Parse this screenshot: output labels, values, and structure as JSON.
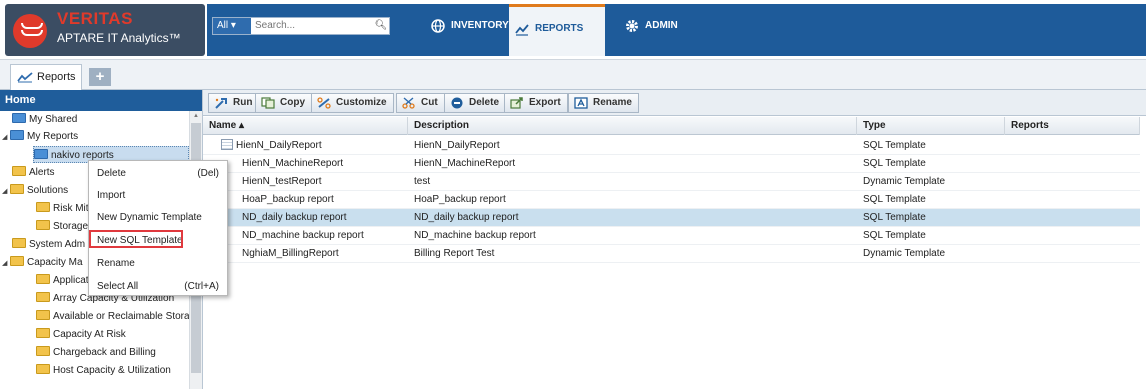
{
  "header": {
    "brand": "VERITAS",
    "product": "APTARE IT Analytics™",
    "search_scope": "All ▾",
    "search_placeholder": "Search...",
    "nav": [
      {
        "label": "INVENTORY",
        "icon": "globe-icon"
      },
      {
        "label": "REPORTS",
        "icon": "chart-icon",
        "active": true
      },
      {
        "label": "ADMIN",
        "icon": "gear-icon"
      }
    ]
  },
  "tabs": {
    "reports_label": "Reports",
    "add_label": "+"
  },
  "sidebar": {
    "title": "Home",
    "tree": [
      {
        "label": "My Shared",
        "icon": "blue"
      },
      {
        "label": "My Reports",
        "icon": "blue",
        "expanded": true
      },
      {
        "label": "nakivo reports",
        "icon": "blue",
        "selected": true
      },
      {
        "label": "Alerts",
        "icon": "yellow"
      },
      {
        "label": "Solutions",
        "icon": "yellow",
        "expanded": true
      },
      {
        "label": "Risk Mitig",
        "icon": "yellow"
      },
      {
        "label": "Storage C",
        "icon": "yellow"
      },
      {
        "label": "System Adm",
        "icon": "yellow"
      },
      {
        "label": "Capacity Ma",
        "icon": "yellow",
        "expanded": true
      },
      {
        "label": "Applicatio",
        "icon": "yellow"
      },
      {
        "label": "Array Capacity & Utilization",
        "icon": "yellow"
      },
      {
        "label": "Available or Reclaimable Storage",
        "icon": "yellow"
      },
      {
        "label": "Capacity At Risk",
        "icon": "yellow"
      },
      {
        "label": "Chargeback and Billing",
        "icon": "yellow"
      },
      {
        "label": "Host Capacity & Utilization",
        "icon": "yellow"
      }
    ]
  },
  "toolbar": {
    "run": "Run",
    "copy": "Copy",
    "customize": "Customize",
    "cut": "Cut",
    "delete": "Delete",
    "export": "Export",
    "rename": "Rename"
  },
  "grid": {
    "columns": [
      "Name ▴",
      "Description",
      "Type",
      "Reports"
    ],
    "rows": [
      {
        "name": "HienN_DailyReport",
        "description": "HienN_DailyReport",
        "type": "SQL Template",
        "reports": ""
      },
      {
        "name": "HienN_MachineReport",
        "description": "HienN_MachineReport",
        "type": "SQL Template",
        "reports": ""
      },
      {
        "name": "HienN_testReport",
        "description": "test",
        "type": "Dynamic Template",
        "reports": ""
      },
      {
        "name": "HoaP_backup report",
        "description": "HoaP_backup report",
        "type": "SQL Template",
        "reports": ""
      },
      {
        "name": "ND_daily backup report",
        "description": "ND_daily backup report",
        "type": "SQL Template",
        "reports": "",
        "selected": true
      },
      {
        "name": "ND_machine backup report",
        "description": "ND_machine backup report",
        "type": "SQL Template",
        "reports": ""
      },
      {
        "name": "NghiaM_BillingReport",
        "description": "Billing Report Test",
        "type": "Dynamic Template",
        "reports": ""
      }
    ]
  },
  "context_menu": {
    "items": [
      {
        "label": "Delete",
        "shortcut": "(Del)"
      },
      {
        "label": "Import",
        "shortcut": ""
      },
      {
        "label": "New Dynamic Template",
        "shortcut": ""
      },
      {
        "label": "New SQL Template",
        "shortcut": "",
        "highlighted": true
      },
      {
        "label": "Rename",
        "shortcut": ""
      },
      {
        "label": "Select All",
        "shortcut": "(Ctrl+A)"
      }
    ]
  },
  "colors": {
    "nav_blue": "#1e5b9a",
    "brand_red": "#e03a2b",
    "highlight_red": "#e0393e",
    "selected_row": "#c9dfee"
  }
}
